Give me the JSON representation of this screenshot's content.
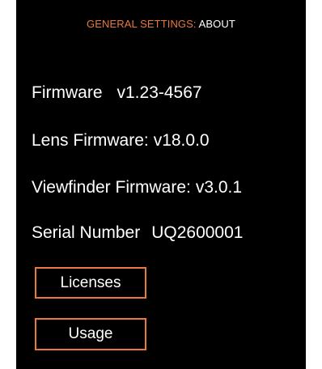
{
  "header": {
    "section": "GENERAL SETTINGS:",
    "page": "ABOUT"
  },
  "info": {
    "firmware_label": "Firmware",
    "firmware_value": "v1.23-4567",
    "lens_label": "Lens Firmware:",
    "lens_value": "v18.0.0",
    "viewfinder_label": "Viewfinder Firmware:",
    "viewfinder_value": "v3.0.1",
    "serial_label": "Serial Number",
    "serial_value": "UQ2600001"
  },
  "buttons": {
    "licenses": "Licenses",
    "usage": "Usage"
  },
  "colors": {
    "accent": "#e87a3c",
    "background": "#000000",
    "text": "#ffffff"
  }
}
